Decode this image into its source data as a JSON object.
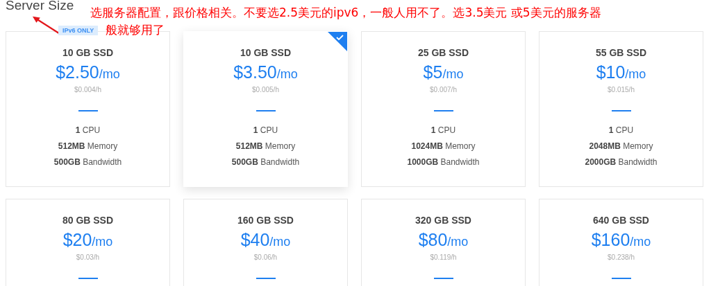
{
  "section": {
    "title": "Server Size"
  },
  "annotation": {
    "lines": [
      "选服务器配置，跟价格相关。不要选2.5美元的ipv6，一般人用不了。选3.5美元 或5美元的服务器",
      "般就够用了"
    ]
  },
  "plans": [
    {
      "storage": "10 GB SSD",
      "price": "$2.50",
      "period": "/mo",
      "hourly": "$0.004/h",
      "badge": "IPv6 ONLY",
      "selected": false,
      "specs": [
        {
          "value": "1",
          "unit": "CPU"
        },
        {
          "value": "512MB",
          "unit": "Memory"
        },
        {
          "value": "500GB",
          "unit": "Bandwidth"
        }
      ]
    },
    {
      "storage": "10 GB SSD",
      "price": "$3.50",
      "period": "/mo",
      "hourly": "$0.005/h",
      "selected": true,
      "specs": [
        {
          "value": "1",
          "unit": "CPU"
        },
        {
          "value": "512MB",
          "unit": "Memory"
        },
        {
          "value": "500GB",
          "unit": "Bandwidth"
        }
      ]
    },
    {
      "storage": "25 GB SSD",
      "price": "$5",
      "period": "/mo",
      "hourly": "$0.007/h",
      "selected": false,
      "specs": [
        {
          "value": "1",
          "unit": "CPU"
        },
        {
          "value": "1024MB",
          "unit": "Memory"
        },
        {
          "value": "1000GB",
          "unit": "Bandwidth"
        }
      ]
    },
    {
      "storage": "55 GB SSD",
      "price": "$10",
      "period": "/mo",
      "hourly": "$0.015/h",
      "selected": false,
      "specs": [
        {
          "value": "1",
          "unit": "CPU"
        },
        {
          "value": "2048MB",
          "unit": "Memory"
        },
        {
          "value": "2000GB",
          "unit": "Bandwidth"
        }
      ]
    },
    {
      "storage": "80 GB SSD",
      "price": "$20",
      "period": "/mo",
      "hourly": "$0.03/h",
      "selected": false
    },
    {
      "storage": "160 GB SSD",
      "price": "$40",
      "period": "/mo",
      "hourly": "$0.06/h",
      "selected": false
    },
    {
      "storage": "320 GB SSD",
      "price": "$80",
      "period": "/mo",
      "hourly": "$0.119/h",
      "selected": false
    },
    {
      "storage": "640 GB SSD",
      "price": "$160",
      "period": "/mo",
      "hourly": "$0.238/h",
      "selected": false
    }
  ]
}
